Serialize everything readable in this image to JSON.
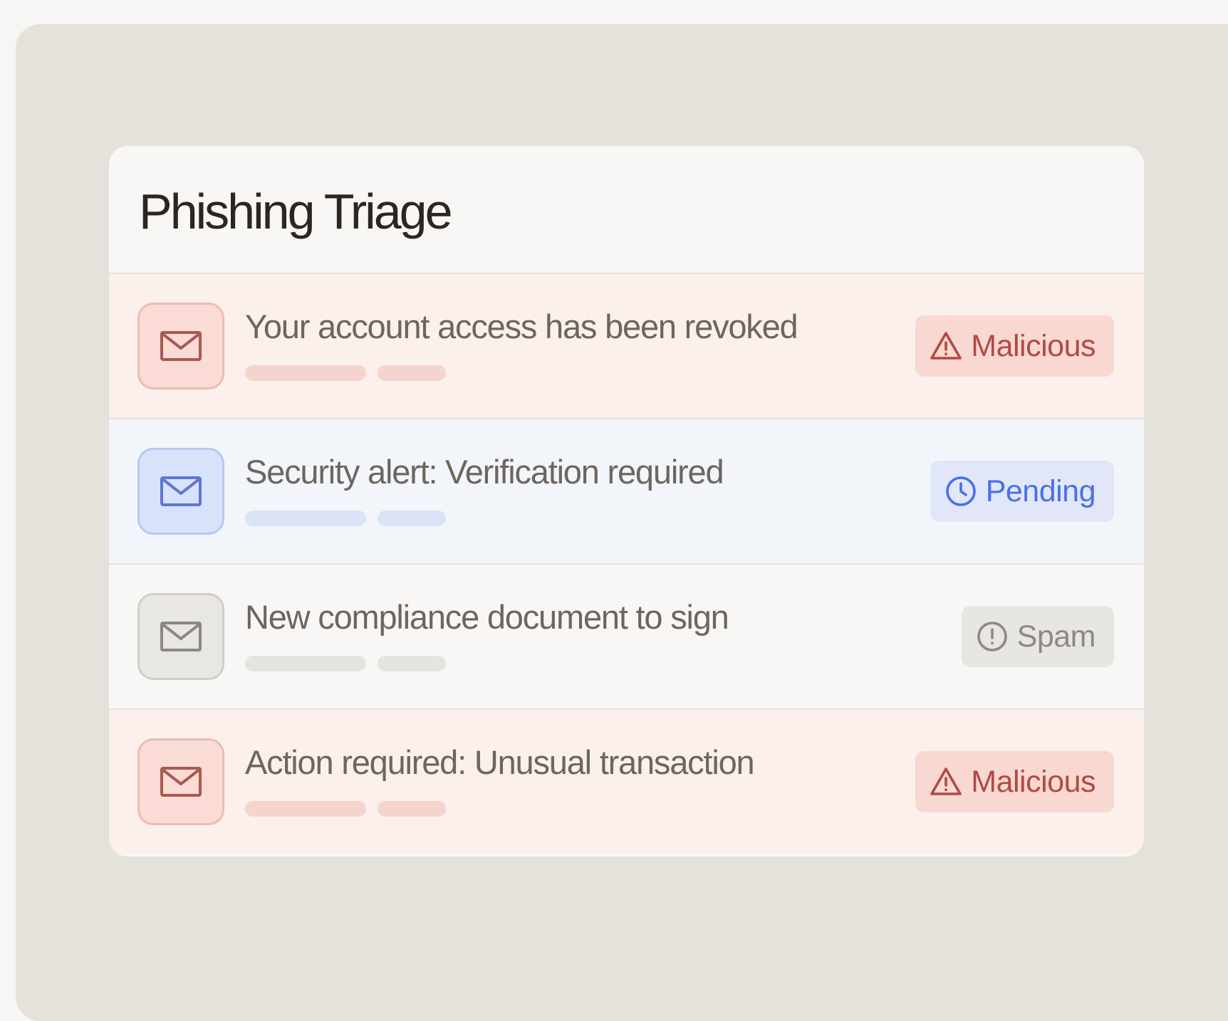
{
  "panel": {
    "title": "Phishing Triage"
  },
  "emails": [
    {
      "subject": "Your account access has been revoked",
      "status": "Malicious",
      "status_icon": "warning-triangle-icon"
    },
    {
      "subject": "Security alert: Verification required",
      "status": "Pending",
      "status_icon": "clock-icon"
    },
    {
      "subject": "New compliance document to sign",
      "status": "Spam",
      "status_icon": "exclamation-circle-icon"
    },
    {
      "subject": "Action required: Unusual transaction",
      "status": "Malicious",
      "status_icon": "warning-triangle-icon"
    }
  ],
  "colors": {
    "malicious": "#b04a45",
    "pending": "#4a70e6",
    "spam": "#8d8a85"
  }
}
